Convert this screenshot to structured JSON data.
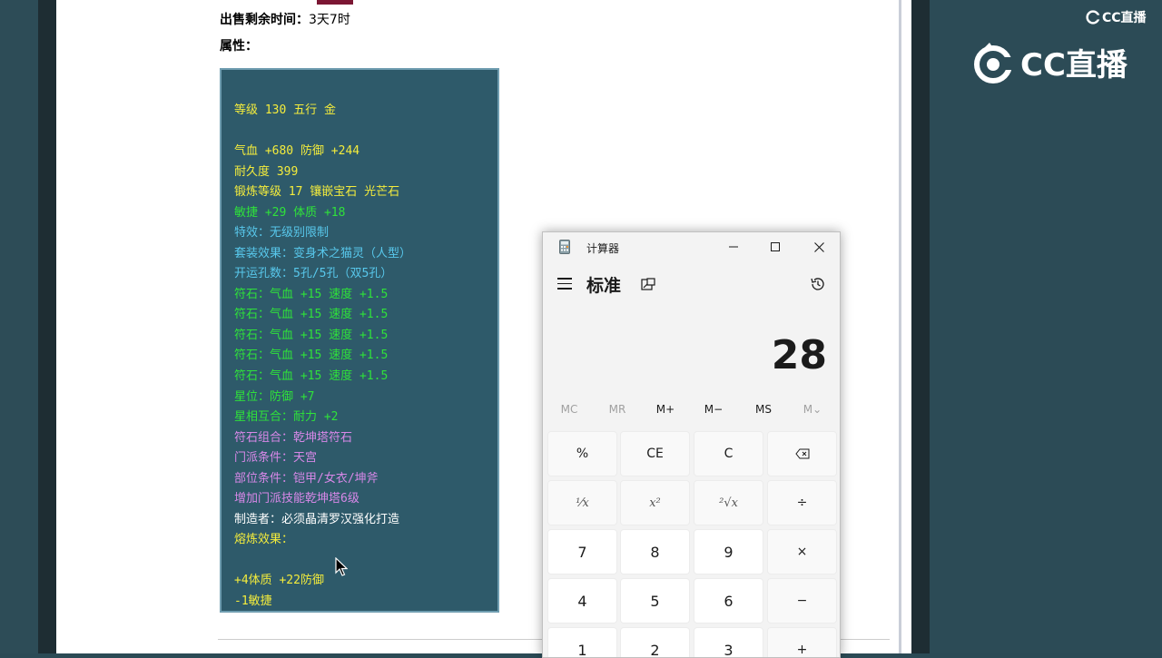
{
  "page": {
    "sale_time_label": "出售剩余时间：",
    "sale_time_value": "3天7时",
    "attr_label": "属性："
  },
  "tooltip": {
    "lines": [
      {
        "text": "等级 130 五行 金",
        "color": "yellow"
      },
      {
        "text": "气血 +680 防御 +244",
        "color": "yellow"
      },
      {
        "text": "耐久度 399",
        "color": "yellow"
      },
      {
        "text": "锻炼等级 17 镶嵌宝石 光芒石",
        "color": "yellow"
      },
      {
        "text": "敏捷 +29 体质 +18",
        "color": "green"
      },
      {
        "text": "特效：无级别限制",
        "color": "cyan"
      },
      {
        "text": "套装效果：变身术之猫灵（人型）",
        "color": "cyan"
      },
      {
        "text": "开运孔数：5孔/5孔（双5孔）",
        "color": "cyan"
      },
      {
        "text": "符石：气血 +15 速度 +1.5",
        "color": "green"
      },
      {
        "text": "符石：气血 +15 速度 +1.5",
        "color": "green"
      },
      {
        "text": "符石：气血 +15 速度 +1.5",
        "color": "green"
      },
      {
        "text": "符石：气血 +15 速度 +1.5",
        "color": "green"
      },
      {
        "text": "符石：气血 +15 速度 +1.5",
        "color": "green"
      },
      {
        "text": "星位：防御 +7",
        "color": "green"
      },
      {
        "text": "星相互合：耐力 +2",
        "color": "green"
      },
      {
        "text": "符石组合：乾坤塔符石",
        "color": "purple"
      },
      {
        "text": "门派条件：天宫",
        "color": "purple"
      },
      {
        "text": "部位条件：铠甲/女衣/坤斧",
        "color": "purple"
      },
      {
        "text": "增加门派技能乾坤塔6级",
        "color": "purple"
      },
      {
        "text": "制造者：必须晶清罗汉强化打造",
        "color": "white"
      },
      {
        "text": "熔炼效果：",
        "color": "yellow"
      },
      {
        "text": "+4体质 +22防御",
        "color": "yellow"
      },
      {
        "text": "-1敏捷",
        "color": "yellow"
      }
    ]
  },
  "logos": {
    "small": "CC直播",
    "big": "CC直播"
  },
  "calculator": {
    "title": "计算器",
    "mode": "标准",
    "display": "28",
    "memory": [
      "MC",
      "MR",
      "M+",
      "M−",
      "MS",
      "M⌄"
    ],
    "keys": [
      [
        "%",
        "CE",
        "C",
        "⌫"
      ],
      [
        "¹⁄x",
        "x²",
        "²√x",
        "÷"
      ],
      [
        "7",
        "8",
        "9",
        "×"
      ],
      [
        "4",
        "5",
        "6",
        "−"
      ],
      [
        "1",
        "2",
        "3",
        "+"
      ]
    ]
  },
  "colors": {
    "tooltip_bg": "#2e5a6a",
    "yellow": "#f4ec3c",
    "green": "#2fe23a",
    "cyan": "#58c8ec",
    "purple": "#d888e8",
    "white": "#ffffff"
  }
}
